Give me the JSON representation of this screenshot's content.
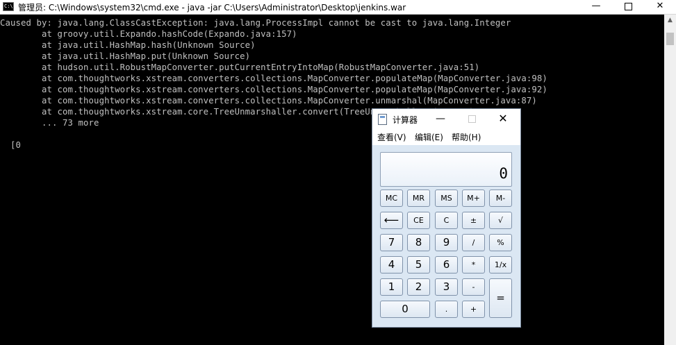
{
  "cmd": {
    "title": "管理员: C:\\Windows\\system32\\cmd.exe - java  -jar C:\\Users\\Administrator\\Desktop\\jenkins.war",
    "icon_label": "C:\\",
    "minimize": "—",
    "close": "✕",
    "lines": [
      "Caused by: java.lang.ClassCastException: java.lang.ProcessImpl cannot be cast to java.lang.Integer",
      "        at groovy.util.Expando.hashCode(Expando.java:157)",
      "        at java.util.HashMap.hash(Unknown Source)",
      "        at java.util.HashMap.put(Unknown Source)",
      "        at hudson.util.RobustMapConverter.putCurrentEntryIntoMap(RobustMapConverter.java:51)",
      "        at com.thoughtworks.xstream.converters.collections.MapConverter.populateMap(MapConverter.java:98)",
      "        at com.thoughtworks.xstream.converters.collections.MapConverter.populateMap(MapConverter.java:92)",
      "        at com.thoughtworks.xstream.converters.collections.MapConverter.unmarshal(MapConverter.java:87)",
      "        at com.thoughtworks.xstream.core.TreeUnmarshaller.convert(TreeUnmarshaller.java:72)",
      "        ... 73 more",
      "",
      "  [0"
    ]
  },
  "calculator": {
    "title": "计算器",
    "minimize": "—",
    "close": "✕",
    "menu": [
      "查看(V)",
      "编辑(E)",
      "帮助(H)"
    ],
    "display": "0",
    "buttons": {
      "mc": "MC",
      "mr": "MR",
      "ms": "MS",
      "mplus": "M+",
      "mminus": "M-",
      "backspace": "⟵",
      "ce": "CE",
      "c": "C",
      "plusminus": "±",
      "sqrt": "√",
      "n7": "7",
      "n8": "8",
      "n9": "9",
      "divide": "/",
      "percent": "%",
      "n4": "4",
      "n5": "5",
      "n6": "6",
      "multiply": "*",
      "reciprocal": "1/x",
      "n1": "1",
      "n2": "2",
      "n3": "3",
      "minus": "-",
      "equals": "=",
      "n0": "0",
      "decimal": ".",
      "plus": "+"
    }
  }
}
